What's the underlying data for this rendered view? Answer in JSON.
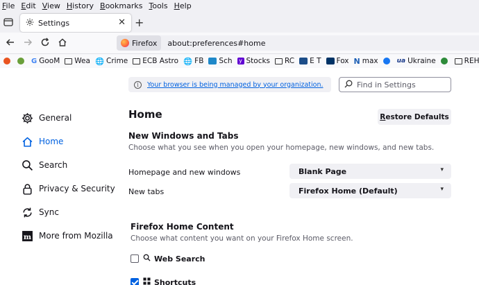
{
  "menubar": {
    "items": [
      {
        "label": "File",
        "key": "F",
        "rest": "ile"
      },
      {
        "label": "Edit",
        "key": "E",
        "rest": "dit"
      },
      {
        "label": "View",
        "key": "V",
        "rest": "iew"
      },
      {
        "label": "History",
        "key": "H",
        "rest": "istory"
      },
      {
        "label": "Bookmarks",
        "key": "B",
        "rest": "ookmarks"
      },
      {
        "label": "Tools",
        "key": "T",
        "rest": "ools"
      },
      {
        "label": "Help",
        "key": "H",
        "rest": "elp"
      }
    ]
  },
  "tab": {
    "title": "Settings",
    "icon": "gear-icon"
  },
  "urlbar": {
    "identity": "Firefox",
    "url": "about:preferences#home"
  },
  "bookmarks": [
    {
      "label": "",
      "icon": "ubuntu",
      "color": "#e95420"
    },
    {
      "label": "",
      "icon": "green-circle",
      "color": "#6a9f3a"
    },
    {
      "label": "GooM",
      "icon": "google",
      "color": "#4285f4"
    },
    {
      "label": "Wea",
      "icon": "folder"
    },
    {
      "label": "Crime",
      "icon": "globe"
    },
    {
      "label": "ECB Astro",
      "icon": "folder"
    },
    {
      "label": "FB",
      "icon": "globe"
    },
    {
      "label": "Sch",
      "icon": "schwab",
      "color": "#1f88c9"
    },
    {
      "label": "Stocks",
      "icon": "yahoo",
      "color": "#6001d2"
    },
    {
      "label": "RC",
      "icon": "folder"
    },
    {
      "label": "E T",
      "icon": "et",
      "color": "#1d4e89"
    },
    {
      "label": "Fox",
      "icon": "fox",
      "color": "#003366"
    },
    {
      "label": "max",
      "icon": "n",
      "color": "#1d5fb4"
    },
    {
      "label": "",
      "icon": "facebook",
      "color": "#1877f2"
    },
    {
      "label": "Ukraine",
      "icon": "ua",
      "color": "#1a3a8a"
    },
    {
      "label": "",
      "icon": "green-globe",
      "color": "#2e8b3a"
    },
    {
      "label": "REHAB",
      "icon": "folder"
    }
  ],
  "policy": {
    "text": "Your browser is being managed by your organization."
  },
  "search": {
    "placeholder": "Find in Settings"
  },
  "sidebar": {
    "items": [
      {
        "label": "General",
        "icon": "gear-icon"
      },
      {
        "label": "Home",
        "icon": "home-icon",
        "active": true
      },
      {
        "label": "Search",
        "icon": "search-icon"
      },
      {
        "label": "Privacy & Security",
        "icon": "lock-icon"
      },
      {
        "label": "Sync",
        "icon": "sync-icon"
      },
      {
        "label": "More from Mozilla",
        "icon": "mozilla-icon"
      }
    ]
  },
  "main": {
    "title": "Home",
    "restore_label": "Restore Defaults",
    "restore_key": "R",
    "restore_rest": "estore Defaults",
    "new_windows": {
      "title": "New Windows and Tabs",
      "desc": "Choose what you see when you open your homepage, new windows, and new tabs.",
      "homepage_label": "Homepage and new windows",
      "homepage_value": "Blank Page",
      "newtabs_label": "New tabs",
      "newtabs_value": "Firefox Home (Default)"
    },
    "home_content": {
      "title": "Firefox Home Content",
      "desc": "Choose what content you want on your Firefox Home screen.",
      "web_search_label": "Web Search",
      "web_search_checked": false,
      "shortcuts_label": "Shortcuts",
      "shortcuts_checked": true
    }
  },
  "colors": {
    "accent": "#0061e0",
    "chrome": "#f0f0f4"
  }
}
